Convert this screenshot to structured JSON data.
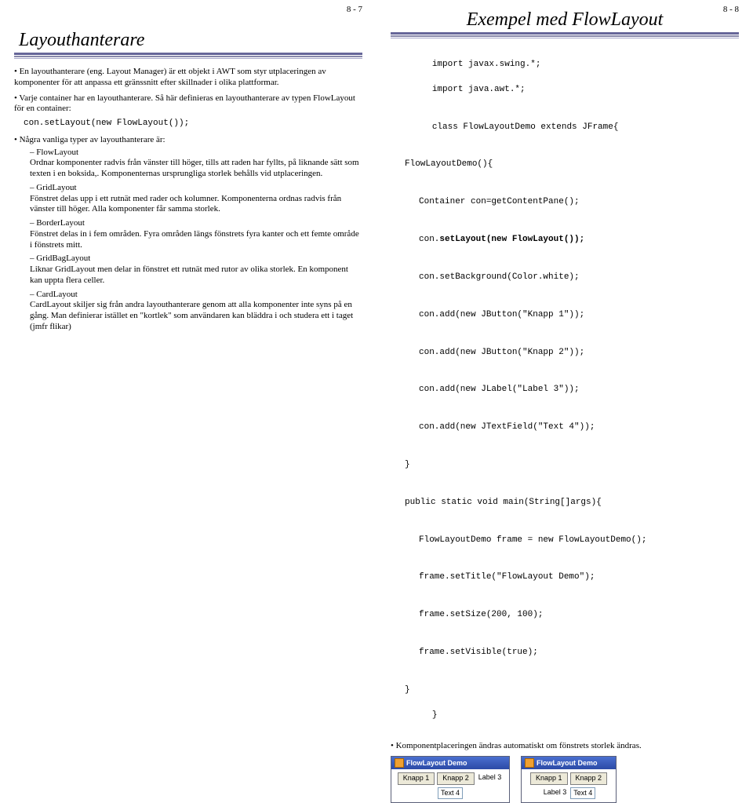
{
  "left": {
    "pagenum": "8 - 7",
    "title": "Layouthanterare",
    "p1": "En layouthanterare (eng. Layout Manager) är ett objekt i AWT som styr utplaceringen av komponenter för att anpassa ett gränssnitt efter skillnader i olika plattformar.",
    "p2": "Varje container har en layouthanterare. Så här definieras en layouthanterare av typen FlowLayout för en container:",
    "code1": "con.setLayout(new FlowLayout());",
    "p3": "Några vanliga typer av layouthanterare är:",
    "flow_h": "FlowLayout",
    "flow_t": "Ordnar komponenter radvis från vänster till höger, tills att raden har fyllts, på liknande sätt som texten i en boksida,. Komponenternas ursprungliga storlek behålls vid utplaceringen.",
    "grid_h": "GridLayout",
    "grid_t": "Fönstret delas upp i ett rutnät med rader och kolumner. Komponenterna ordnas radvis från vänster till höger. Alla komponenter får samma storlek.",
    "border_h": "BorderLayout",
    "border_t": "Fönstret delas in i fem områden. Fyra områden längs fönstrets fyra kanter och ett femte område i fönstrets mitt.",
    "gbag_h": "GridBagLayout",
    "gbag_t": "Liknar GridLayout men delar in fönstret ett rutnät med rutor av olika storlek. En komponent kan uppta flera celler.",
    "card_h": "CardLayout",
    "card_t": "CardLayout skiljer sig från andra layouthanterare genom att alla komponenter inte syns på en gång. Man definierar istället en \"kortlek\" som användaren kan bläddra i och studera ett i taget (jmfr flikar)"
  },
  "right": {
    "pagenum": "8 - 8",
    "title": "Exempel med FlowLayout",
    "c0a": "import javax.swing.*;",
    "c0b": "import java.awt.*;",
    "c1": "class FlowLayoutDemo extends JFrame{",
    "c2": "FlowLayoutDemo(){",
    "c3": "Container con=getContentPane();",
    "c4a": "con.",
    "c4b": "setLayout(new FlowLayout());",
    "c5": "con.setBackground(Color.white);",
    "c6": "con.add(new JButton(\"Knapp 1\"));",
    "c7": "con.add(new JButton(\"Knapp 2\"));",
    "c8": "con.add(new JLabel(\"Label 3\"));",
    "c9": "con.add(new JTextField(\"Text 4\"));",
    "c10": "}",
    "c11": "public static void main(String[]args){",
    "c12": "FlowLayoutDemo frame = new FlowLayoutDemo();",
    "c13": "frame.setTitle(\"FlowLayout Demo\");",
    "c14": "frame.setSize(200, 100);",
    "c15": "frame.setVisible(true);",
    "c16": "}",
    "c17": "}",
    "note": "Komponentplaceringen ändras automatiskt om fönstrets storlek ändras.",
    "win_title": "FlowLayout Demo",
    "btn1": "Knapp 1",
    "btn2": "Knapp 2",
    "lbl3": "Label 3",
    "tf4": "Text 4"
  }
}
